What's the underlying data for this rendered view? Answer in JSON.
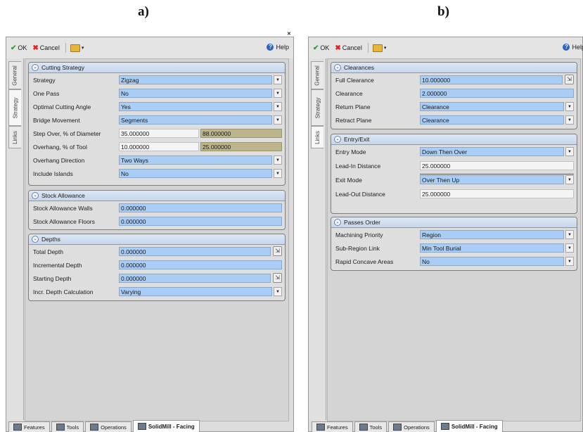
{
  "captions": {
    "a": "a)",
    "b": "b)"
  },
  "toolbar": {
    "ok": "OK",
    "cancel": "Cancel",
    "help": "Help"
  },
  "side_tabs": {
    "general": "General",
    "strategy": "Strategy",
    "links": "Links"
  },
  "bottom_tabs": {
    "features": "Features",
    "tools": "Tools",
    "operations": "Operations",
    "solidmill": "SolidMill - Facing"
  },
  "panel_a": {
    "cutting": {
      "title": "Cutting Strategy",
      "strategy": {
        "label": "Strategy",
        "value": "Zigzag"
      },
      "one_pass": {
        "label": "One Pass",
        "value": "No"
      },
      "optimal_angle": {
        "label": "Optimal Cutting Angle",
        "value": "Yes"
      },
      "bridge": {
        "label": "Bridge Movement",
        "value": "Segments"
      },
      "step_over": {
        "label": "Step Over, % of Diameter",
        "value": "35.000000",
        "value2": "88.000000"
      },
      "overhang": {
        "label": "Overhang, % of Tool",
        "value": "10.000000",
        "value2": "25.000000"
      },
      "overhang_dir": {
        "label": "Overhang Direction",
        "value": "Two Ways"
      },
      "include_islands": {
        "label": "Include Islands",
        "value": "No"
      }
    },
    "stock": {
      "title": "Stock Allowance",
      "walls": {
        "label": "Stock Allowance Walls",
        "value": "0.000000"
      },
      "floors": {
        "label": "Stock Allowance Floors",
        "value": "0.000000"
      }
    },
    "depths": {
      "title": "Depths",
      "total": {
        "label": "Total Depth",
        "value": "0.000000"
      },
      "incremental": {
        "label": "Incremental Depth",
        "value": "0.000000"
      },
      "starting": {
        "label": "Starting Depth",
        "value": "0.000000"
      },
      "incr_calc": {
        "label": "Incr. Depth Calculation",
        "value": "Varying"
      }
    }
  },
  "panel_b": {
    "clearances": {
      "title": "Clearances",
      "full": {
        "label": "Full Clearance",
        "value": "10.000000"
      },
      "clearance": {
        "label": "Clearance",
        "value": "2.000000"
      },
      "return_plane": {
        "label": "Return Plane",
        "value": "Clearance"
      },
      "retract_plane": {
        "label": "Retract Plane",
        "value": "Clearance"
      }
    },
    "entry_exit": {
      "title": "Entry/Exit",
      "entry_mode": {
        "label": "Entry Mode",
        "value": "Down Then Over"
      },
      "lead_in": {
        "label": "Lead-In Distance",
        "value": "25.000000"
      },
      "exit_mode": {
        "label": "Exit Mode",
        "value": "Over Then Up"
      },
      "lead_out": {
        "label": "Lead-Out Distance",
        "value": "25.000000"
      }
    },
    "passes": {
      "title": "Passes Order",
      "priority": {
        "label": "Machining Priority",
        "value": "Region"
      },
      "subregion": {
        "label": "Sub-Region Link",
        "value": "Min Tool Burial"
      },
      "rapid": {
        "label": "Rapid Concave Areas",
        "value": "No"
      }
    }
  }
}
